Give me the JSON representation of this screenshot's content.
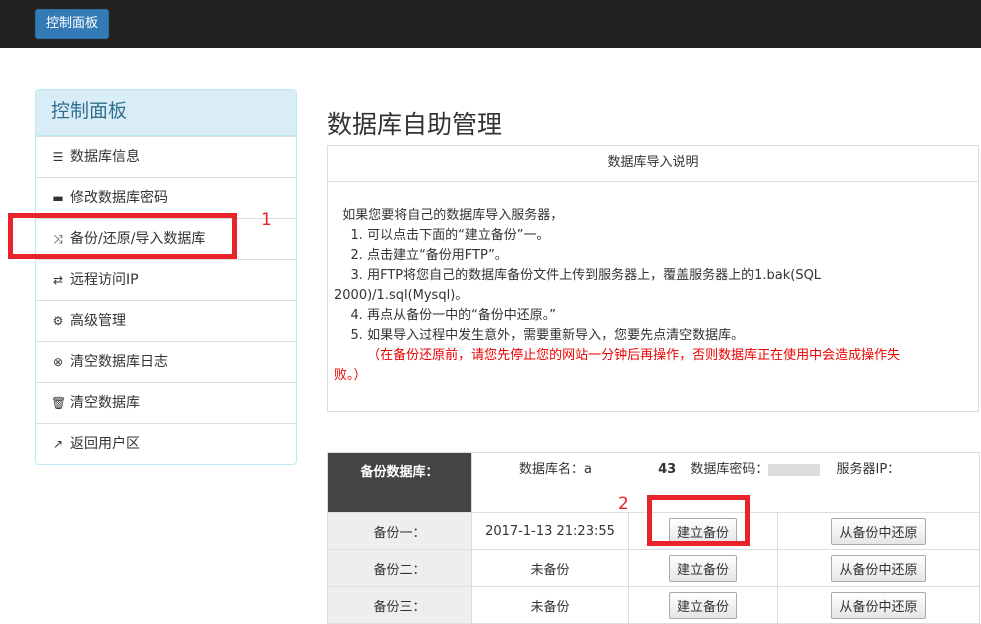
{
  "topbar": {
    "button_label": "控制面板"
  },
  "sidebar": {
    "title": "控制面板",
    "items": [
      {
        "icon": "list-icon",
        "glyph": "☰",
        "label": "数据库信息"
      },
      {
        "icon": "drive-icon",
        "glyph": "▬",
        "label": "修改数据库密码"
      },
      {
        "icon": "shuffle-icon",
        "glyph": "⤨",
        "label": "备份/还原/导入数据库"
      },
      {
        "icon": "transfer-icon",
        "glyph": "⇄",
        "label": "远程访问IP"
      },
      {
        "icon": "gear-icon",
        "glyph": "⚙",
        "label": "高级管理"
      },
      {
        "icon": "remove-circle-icon",
        "glyph": "⊗",
        "label": "清空数据库日志"
      },
      {
        "icon": "trash-icon",
        "glyph": "🗑",
        "label": "清空数据库"
      },
      {
        "icon": "share-icon",
        "glyph": "↗",
        "label": "返回用户区"
      }
    ]
  },
  "annotations": {
    "mark1": "1",
    "mark2": "2"
  },
  "main": {
    "title": "数据库自助管理",
    "import_box": {
      "heading": "数据库导入说明",
      "lines": [
        "  如果您要将自己的数据库导入服务器，",
        "    1. 可以点击下面的“建立备份”一。",
        "    2. 点击建立“备份用FTP”。",
        "    3. 用FTP将您自己的数据库备份文件上传到服务器上，覆盖服务器上的1.bak(SQL",
        "2000)/1.sql(Mysql)。",
        "    4. 再点从备份一中的“备份中还原。”",
        "    5. 如果导入过程中发生意外，需要重新导入，您要先点清空数据库。"
      ],
      "warning_line1": "        （在备份还原前，请您先停止您的网站一分钟后再操作，否则数据库正在使用中会造成操作失",
      "warning_line2": "败。）"
    },
    "backup_table": {
      "header_label": "备份数据库：",
      "db_name_label": "数据库名：a",
      "db_name_suffix": "43",
      "db_password_label": "数据库密码：",
      "server_ip_label": "服务器IP：",
      "rows": [
        {
          "label": "备份一：",
          "status": "2017-1-13 21:23:55",
          "create_label": "建立备份",
          "restore_label": "从备份中还原"
        },
        {
          "label": "备份二：",
          "status": "未备份",
          "create_label": "建立备份",
          "restore_label": "从备份中还原"
        },
        {
          "label": "备份三：",
          "status": "未备份",
          "create_label": "建立备份",
          "restore_label": "从备份中还原"
        }
      ]
    }
  },
  "colors": {
    "topbar": "#222222",
    "accent": "#337ab7",
    "panel_header": "#d9edf7",
    "highlight": "#e8232b"
  }
}
